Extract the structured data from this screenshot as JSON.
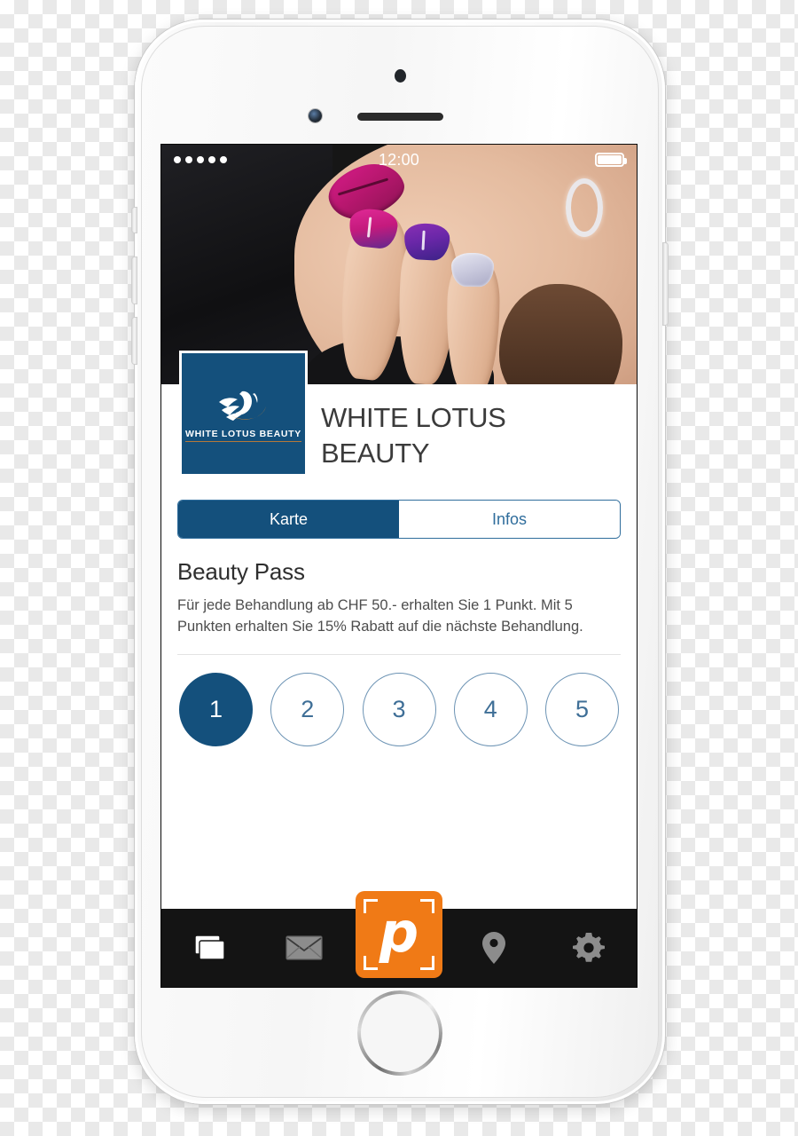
{
  "device": {
    "name": "white-iphone",
    "sensor": "proximity-sensor",
    "camera": "front-camera",
    "speaker": "earpiece-speaker",
    "home_button": "home-button"
  },
  "statusbar": {
    "signal_dots": 5,
    "time": "12:00",
    "battery": "full"
  },
  "hero": {
    "alt": "beauty-model-photo"
  },
  "brand": {
    "logo_caption": "WHITE LOTUS BEAUTY",
    "title": "WHITE LOTUS BEAUTY",
    "title_line1": "WHITE LOTUS",
    "title_line2": "BEAUTY"
  },
  "segmented": {
    "active_index": 0,
    "tabs": [
      {
        "label": "Karte",
        "active": true
      },
      {
        "label": "Infos",
        "active": false
      }
    ]
  },
  "pass": {
    "title": "Beauty Pass",
    "description": "Für jede Behandlung ab CHF 50.- erhalten Sie 1 Punkt. Mit 5 Punkten erhalten Sie 15% Rabatt auf die nächste Behandlung.",
    "points": [
      {
        "number": "1",
        "earned": true
      },
      {
        "number": "2",
        "earned": false
      },
      {
        "number": "3",
        "earned": false
      },
      {
        "number": "4",
        "earned": false
      },
      {
        "number": "5",
        "earned": false
      }
    ],
    "points_total": 5,
    "points_earned": 1
  },
  "tabbar": {
    "items": [
      {
        "icon": "cards-icon",
        "label": "Karten",
        "active": true
      },
      {
        "icon": "envelope-icon",
        "label": "Nachrichten",
        "active": false
      },
      {
        "icon": "scan-p-icon",
        "label": "p",
        "active": false
      },
      {
        "icon": "location-pin-icon",
        "label": "Orte",
        "active": false
      },
      {
        "icon": "gear-icon",
        "label": "Einstellungen",
        "active": false
      }
    ],
    "scan_label": "p"
  },
  "colors": {
    "brand_blue": "#14507c",
    "brand_blue_border": "#2f6d9c",
    "point_outline": "#6c93b4",
    "point_text": "#3f6f97",
    "accent_orange": "#f07a16",
    "tabbar_bg": "#141414",
    "icon_inactive": "#8c8c8c",
    "icon_active": "#ffffff",
    "logo_underline": "#b5783a"
  }
}
